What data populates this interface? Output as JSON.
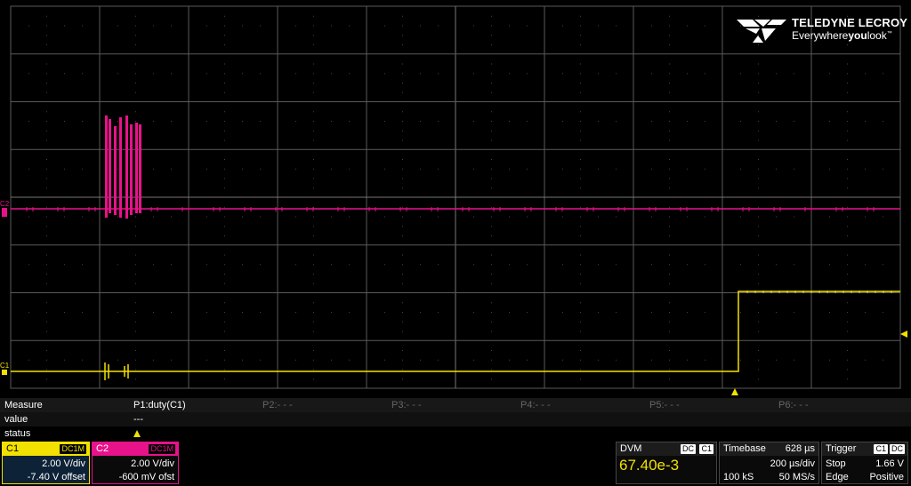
{
  "logo": {
    "brand": "TELEDYNE LECROY",
    "tag_pre": "Everywhere",
    "tag_bold": "you",
    "tag_post": "look",
    "tag_tm": "™"
  },
  "markers": {
    "c2_label": "C2",
    "c1_label": "C1"
  },
  "colors": {
    "c1": "#f2e100",
    "c2": "#e8128a",
    "grid": "#5a5a5a",
    "background": "#000000"
  },
  "measure": {
    "header": "Measure",
    "row_value": "value",
    "row_status": "status",
    "params": [
      {
        "label": "P1:duty(C1)",
        "value": "---",
        "status_warn": true,
        "active": true
      },
      {
        "label": "P2:- - -",
        "value": "",
        "status_warn": false,
        "active": false
      },
      {
        "label": "P3:- - -",
        "value": "",
        "status_warn": false,
        "active": false
      },
      {
        "label": "P4:- - -",
        "value": "",
        "status_warn": false,
        "active": false
      },
      {
        "label": "P5:- - -",
        "value": "",
        "status_warn": false,
        "active": false
      },
      {
        "label": "P6:- - -",
        "value": "",
        "status_warn": false,
        "active": false
      }
    ]
  },
  "c1": {
    "label": "C1",
    "coupling": "DC1M",
    "vdiv": "2.00 V/div",
    "offset": "-7.40 V offset"
  },
  "c2": {
    "label": "C2",
    "coupling": "DC1M",
    "vdiv": "2.00 V/div",
    "offset": "-600 mV ofst"
  },
  "dvm": {
    "label": "DVM",
    "mode": "DC",
    "channel": "C1",
    "reading": "67.40e-3"
  },
  "timebase": {
    "label": "Timebase",
    "delay": "628 µs",
    "tdiv": "200 µs/div",
    "samples": "100 kS",
    "rate": "50 MS/s"
  },
  "trigger": {
    "label": "Trigger",
    "source": "C1",
    "coupling": "DC",
    "mode": "Stop",
    "level": "1.66 V",
    "type": "Edge",
    "slope": "Positive"
  }
}
